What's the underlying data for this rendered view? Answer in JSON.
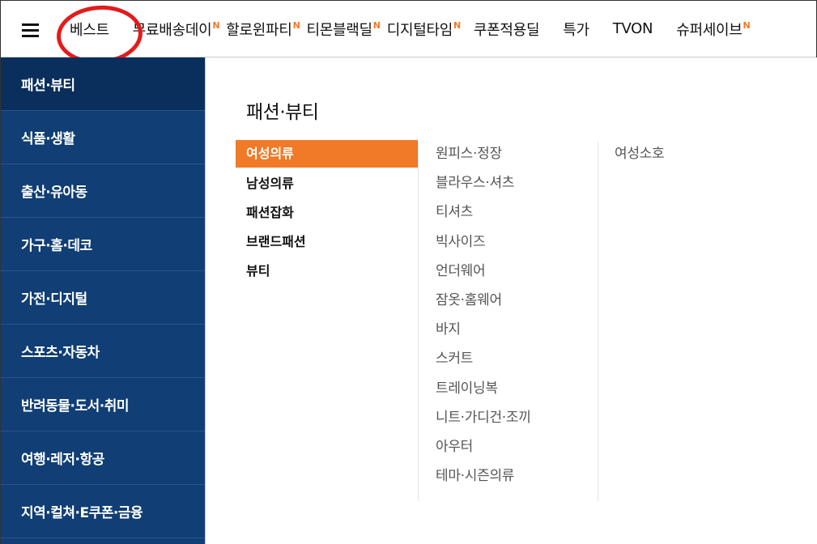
{
  "topnav": {
    "items": [
      {
        "label": "베스트",
        "badge": ""
      },
      {
        "label": "무료배송데이",
        "badge": "N"
      },
      {
        "label": "할로윈파티",
        "badge": "N"
      },
      {
        "label": "티몬블랙딜",
        "badge": "N"
      },
      {
        "label": "디지털타임",
        "badge": "N"
      },
      {
        "label": "쿠폰적용딜",
        "badge": ""
      },
      {
        "label": "특가",
        "badge": ""
      },
      {
        "label": "TVON",
        "badge": ""
      },
      {
        "label": "슈퍼세이브",
        "badge": "N"
      }
    ]
  },
  "sidebar": {
    "items": [
      {
        "label": "패션·뷰티"
      },
      {
        "label": "식품·생활"
      },
      {
        "label": "출산·유아동"
      },
      {
        "label": "가구·홈·데코"
      },
      {
        "label": "가전·디지털"
      },
      {
        "label": "스포츠·자동차"
      },
      {
        "label": "반려동물·도서·취미"
      },
      {
        "label": "여행·레저·항공"
      },
      {
        "label": "지역·컬쳐·E쿠폰·금융"
      }
    ]
  },
  "main": {
    "title": "패션·뷰티",
    "categories": [
      {
        "label": "여성의류"
      },
      {
        "label": "남성의류"
      },
      {
        "label": "패션잡화"
      },
      {
        "label": "브랜드패션"
      },
      {
        "label": "뷰티"
      }
    ],
    "subcategories": [
      {
        "label": "원피스·정장"
      },
      {
        "label": "블라우스·셔츠"
      },
      {
        "label": "티셔츠"
      },
      {
        "label": "빅사이즈"
      },
      {
        "label": "언더웨어"
      },
      {
        "label": "잠옷·홈웨어"
      },
      {
        "label": "바지"
      },
      {
        "label": "스커트"
      },
      {
        "label": "트레이닝복"
      },
      {
        "label": "니트·가디건·조끼"
      },
      {
        "label": "아우터"
      },
      {
        "label": "테마·시즌의류"
      }
    ],
    "extra": [
      {
        "label": "여성소호"
      }
    ]
  },
  "colors": {
    "accent": "#f07a27",
    "sidebar": "#103e75",
    "annotation": "#e41b1b"
  }
}
